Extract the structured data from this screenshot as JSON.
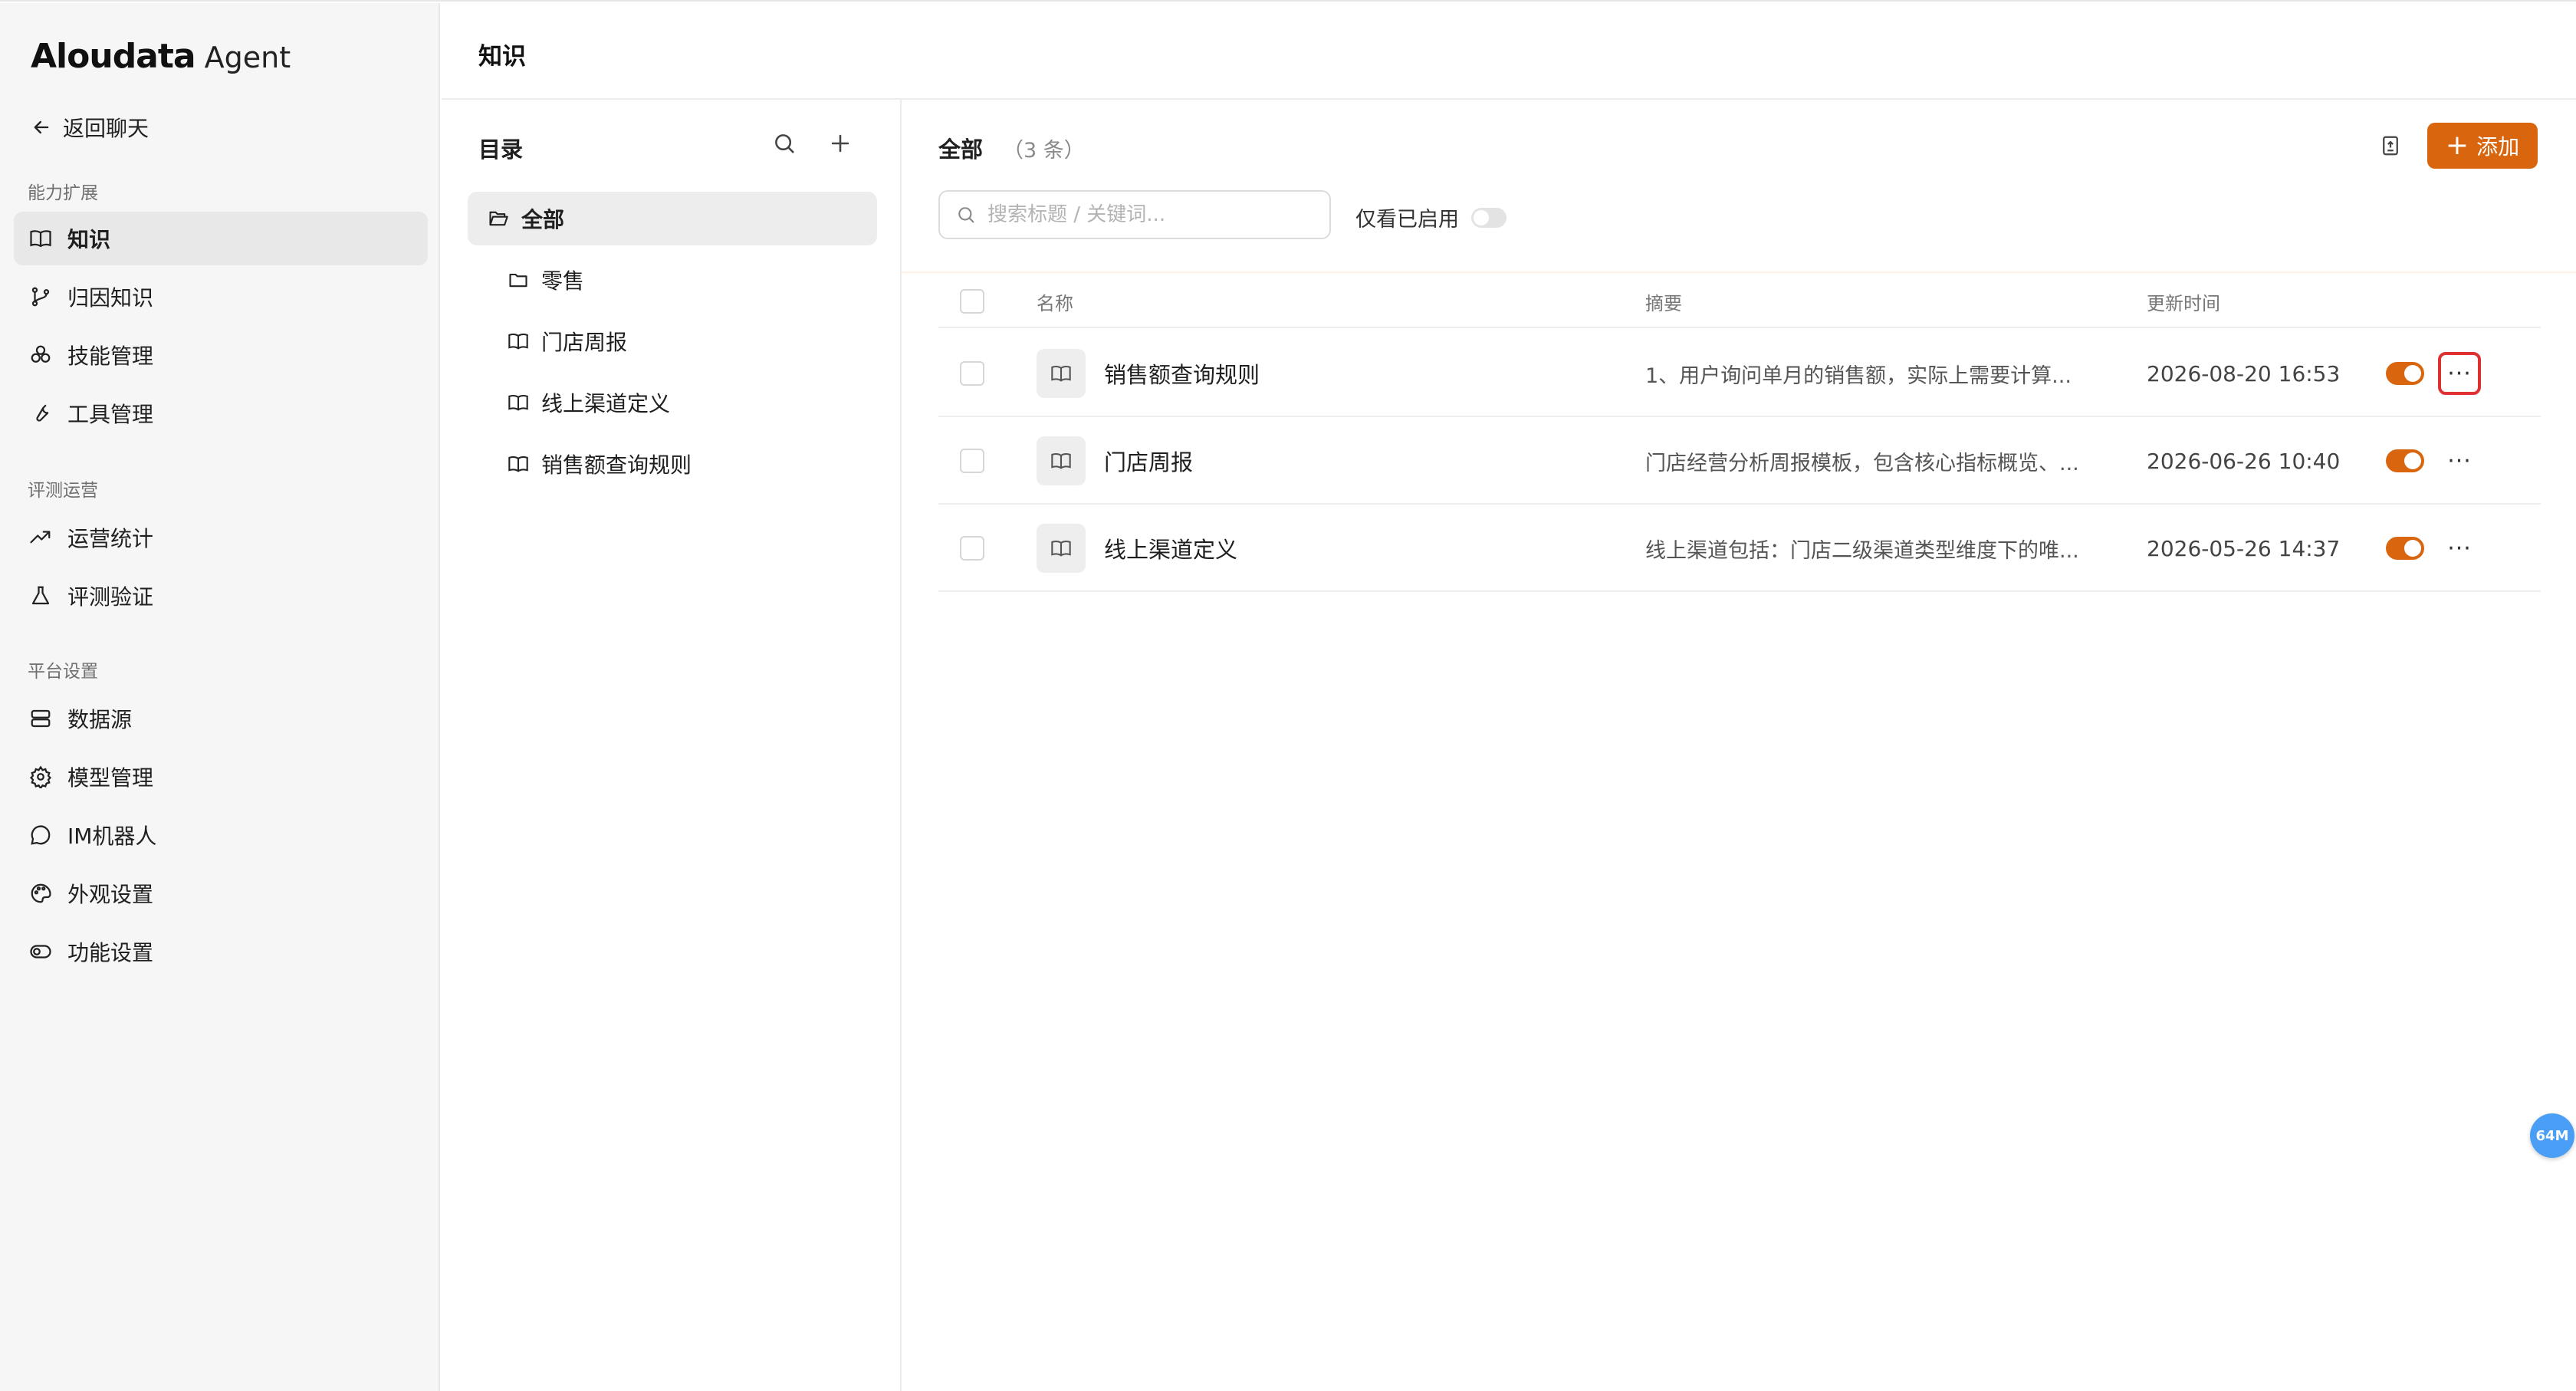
{
  "app": {
    "logo_main": "Aloudata",
    "logo_sub": "Agent",
    "back_label": "返回聊天"
  },
  "sidebar": {
    "sections": [
      {
        "title": "能力扩展"
      },
      {
        "title": "评测运营"
      },
      {
        "title": "平台设置"
      }
    ],
    "items": [
      {
        "label": "知识",
        "icon": "book-icon",
        "active": true
      },
      {
        "label": "归因知识",
        "icon": "branch-icon"
      },
      {
        "label": "技能管理",
        "icon": "cubes-icon"
      },
      {
        "label": "工具管理",
        "icon": "wrench-icon"
      },
      {
        "label": "运营统计",
        "icon": "trend-icon"
      },
      {
        "label": "评测验证",
        "icon": "flask-icon"
      },
      {
        "label": "数据源",
        "icon": "database-icon"
      },
      {
        "label": "模型管理",
        "icon": "gear-icon"
      },
      {
        "label": "IM机器人",
        "icon": "chat-icon"
      },
      {
        "label": "外观设置",
        "icon": "palette-icon"
      },
      {
        "label": "功能设置",
        "icon": "toggle-icon"
      }
    ]
  },
  "header": {
    "title": "知识"
  },
  "catalog": {
    "title": "目录",
    "items": [
      {
        "label": "全部",
        "icon": "folder-open-icon"
      },
      {
        "label": "零售",
        "icon": "folder-icon"
      },
      {
        "label": "门店周报",
        "icon": "book-icon"
      },
      {
        "label": "线上渠道定义",
        "icon": "book-icon"
      },
      {
        "label": "销售额查询规则",
        "icon": "book-icon"
      }
    ]
  },
  "content": {
    "heading": "全部",
    "count": "（3 条）",
    "add_label": "添加",
    "search_placeholder": "搜索标题 / 关键词...",
    "only_enabled_label": "仅看已启用",
    "columns": {
      "name": "名称",
      "summary": "摘要",
      "updated": "更新时间"
    },
    "rows": [
      {
        "name": "销售额查询规则",
        "summary": "1、用户询问单月的销售额，实际上需要计算...",
        "updated": "2026-08-20 16:53",
        "enabled": true
      },
      {
        "name": "门店周报",
        "summary": "门店经营分析周报模板，包含核心指标概览、...",
        "updated": "2026-06-26 10:40",
        "enabled": true
      },
      {
        "name": "线上渠道定义",
        "summary": "线上渠道包括：门店二级渠道类型维度下的唯...",
        "updated": "2026-05-26 14:37",
        "enabled": true
      }
    ]
  },
  "badge": {
    "memory": "64M"
  },
  "colors": {
    "accent": "#d9660f",
    "highlight": "#e03131",
    "badge": "#4a9ef5"
  }
}
